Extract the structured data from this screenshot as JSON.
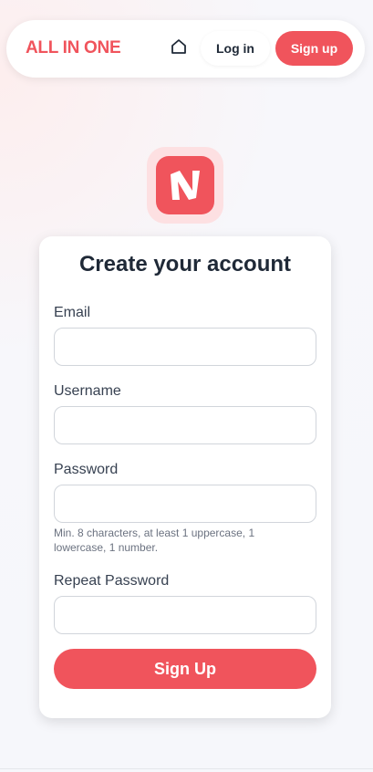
{
  "brand": {
    "name": "ALL IN ONE",
    "color": "#f0545c"
  },
  "nav": {
    "home_icon": "home-icon",
    "login_label": "Log in",
    "signup_label": "Sign up"
  },
  "logo": {
    "icon": "app-logo-n-icon"
  },
  "form": {
    "title": "Create your account",
    "email_label": "Email",
    "email_value": "",
    "username_label": "Username",
    "username_value": "",
    "password_label": "Password",
    "password_value": "",
    "password_hint": "Min. 8 characters, at least 1 uppercase, 1 lowercase, 1 number.",
    "repeat_password_label": "Repeat Password",
    "repeat_password_value": "",
    "submit_label": "Sign Up"
  }
}
